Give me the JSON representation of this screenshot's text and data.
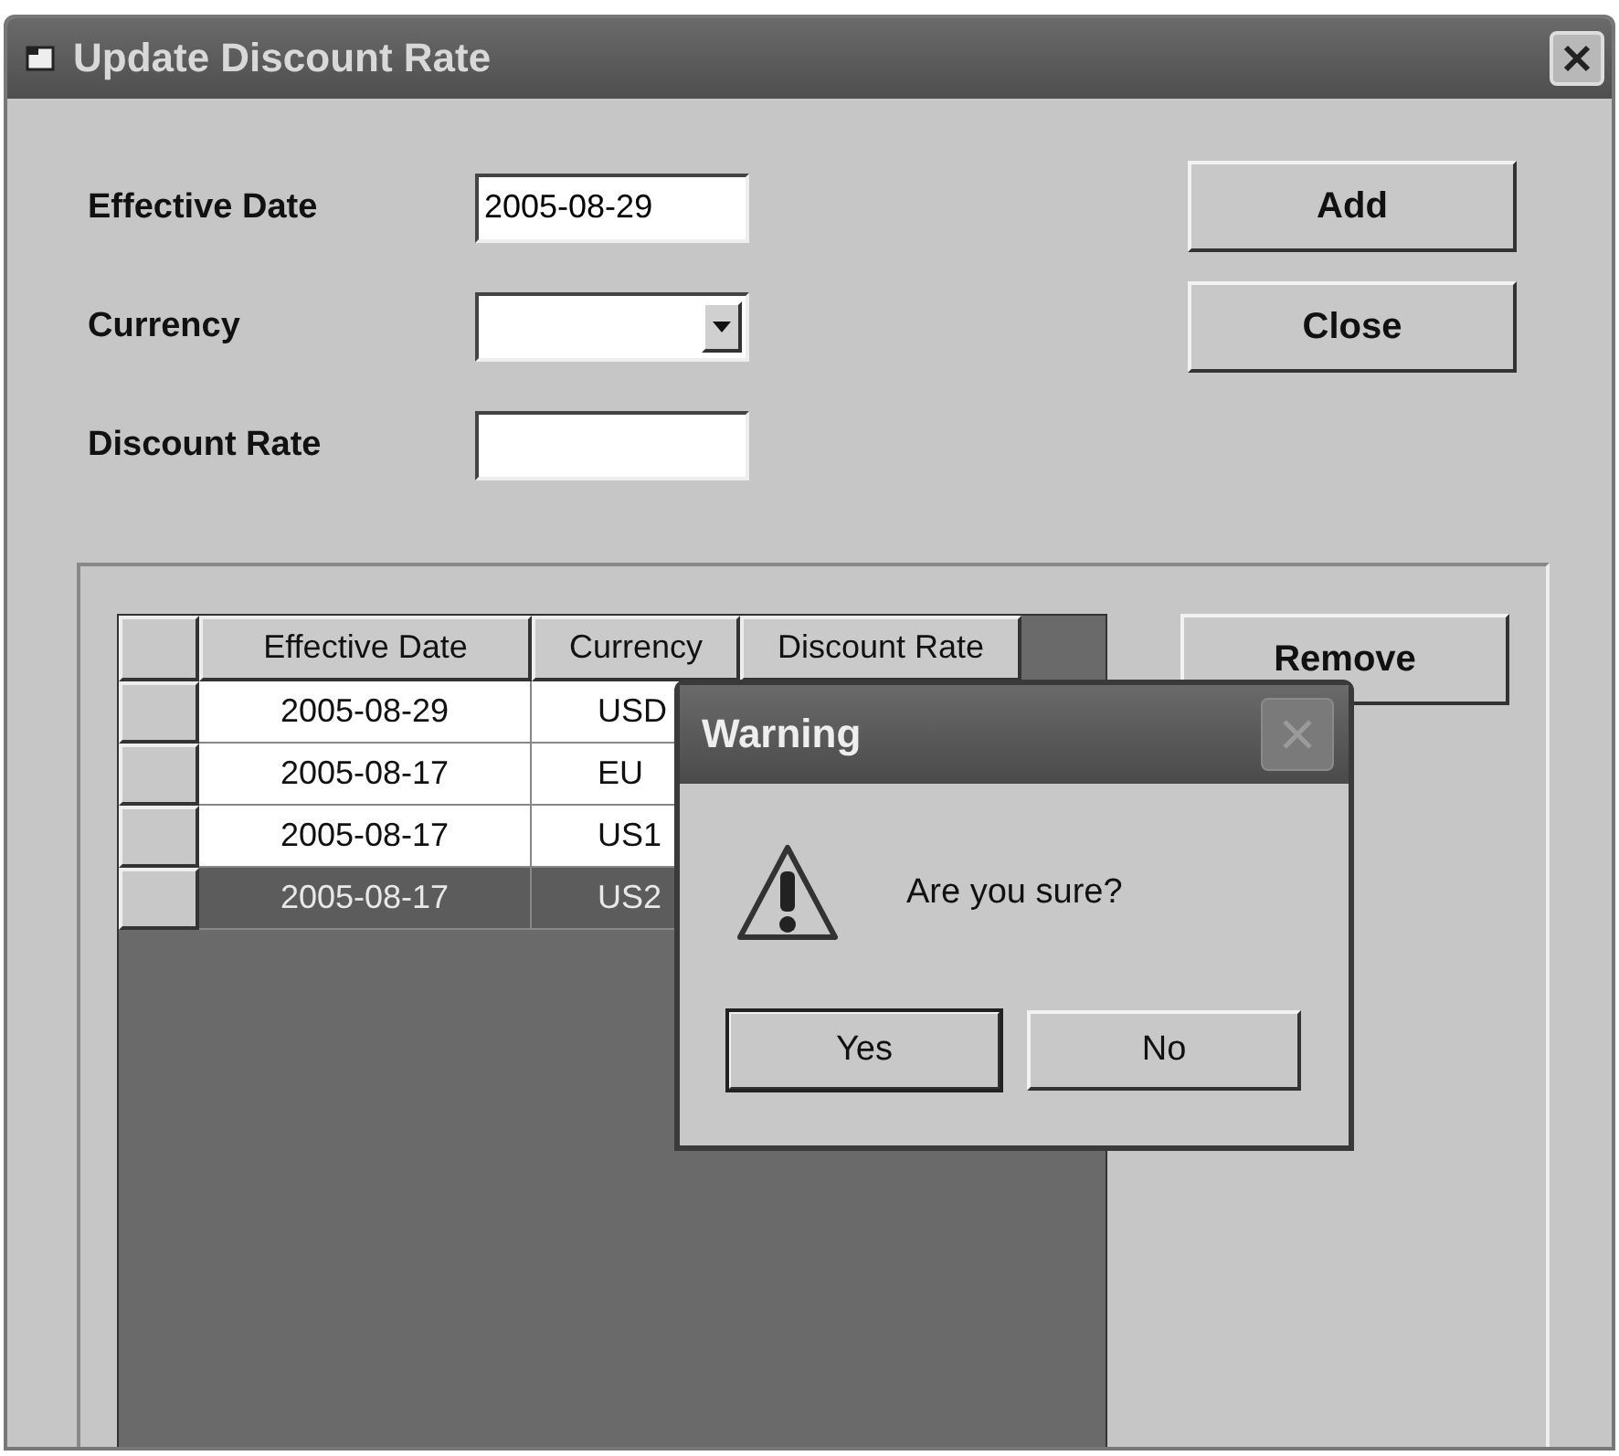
{
  "window": {
    "title": "Update Discount Rate"
  },
  "form": {
    "fields": [
      {
        "kind": "text",
        "label": "Effective Date",
        "value": "2005-08-29"
      },
      {
        "kind": "dropdown",
        "label": "Currency"
      },
      {
        "kind": "text",
        "label": "Discount Rate"
      }
    ]
  },
  "buttons": [
    "Add",
    "Close"
  ],
  "grid": {
    "columns": [
      "Effective Date",
      "Currency",
      "Discount Rate"
    ],
    "rows": [
      {
        "cells": [
          "2005-08-29",
          "USD"
        ],
        "selected": false
      },
      {
        "cells": [
          "2005-08-17",
          "EU"
        ],
        "selected": false
      },
      {
        "cells": [
          "2005-08-17",
          "US1"
        ],
        "selected": false
      },
      {
        "cells": [
          "2005-08-17",
          "US2"
        ],
        "selected": true
      }
    ]
  },
  "remove_button": "Remove",
  "dialog": {
    "title": "Warning",
    "message": "Are you sure?",
    "buttons": [
      {
        "label": "Yes",
        "focused": true
      },
      {
        "label": "No",
        "focused": false
      }
    ]
  }
}
